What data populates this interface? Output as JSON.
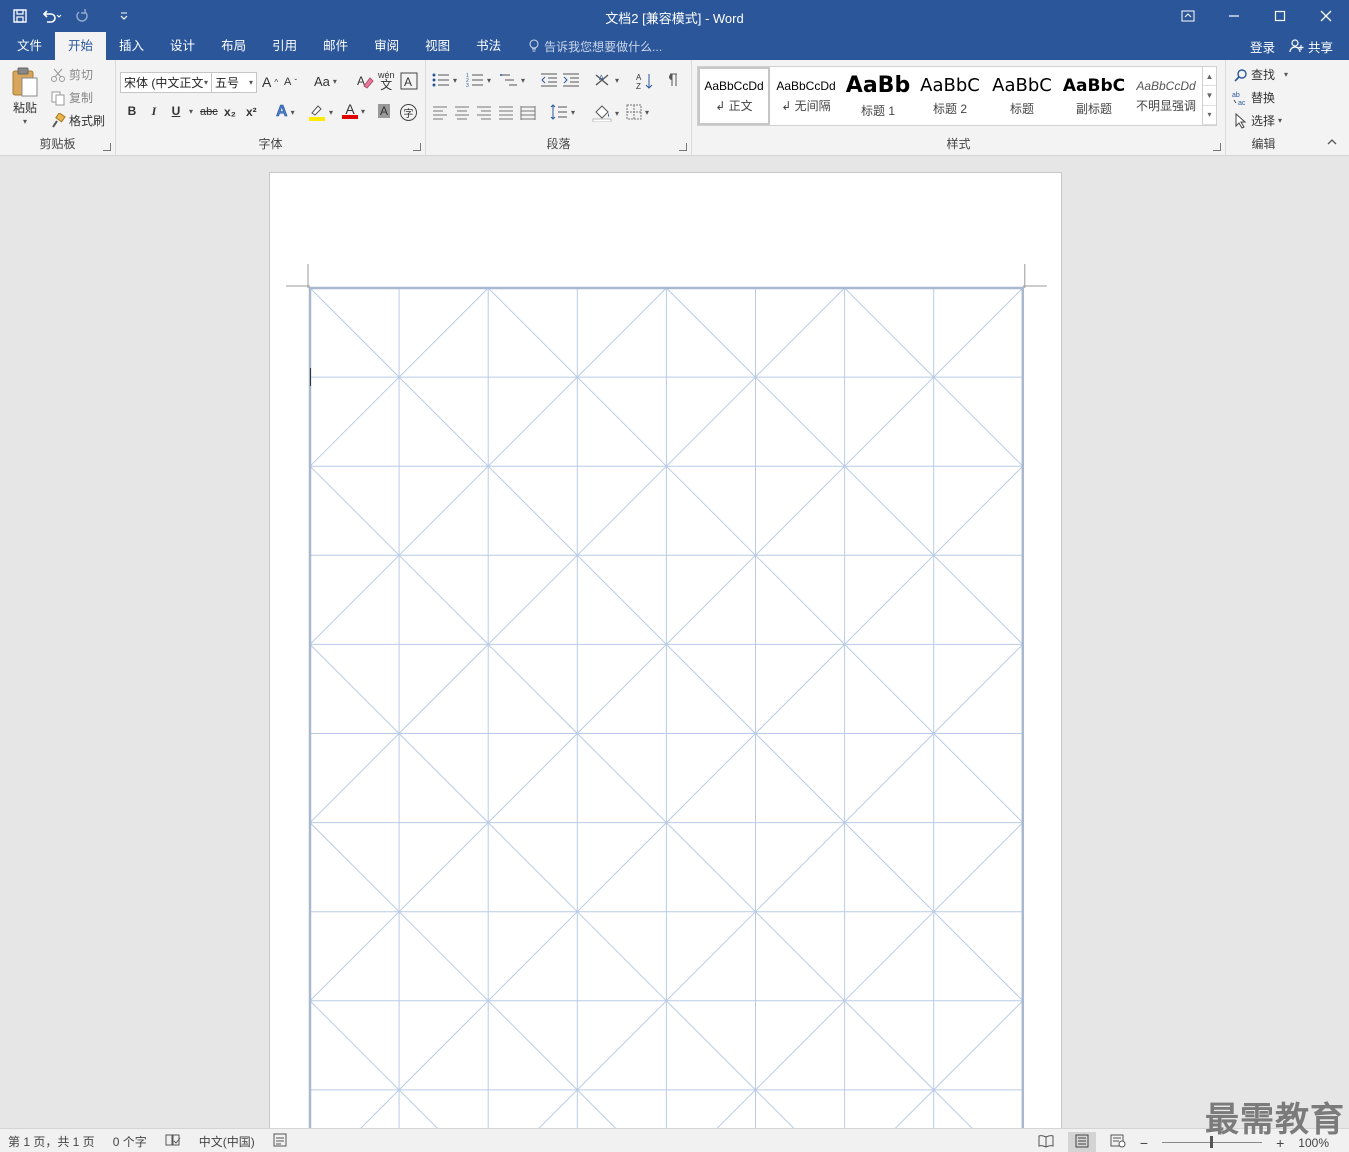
{
  "window": {
    "title": "文档2 [兼容模式] - Word"
  },
  "menu": {
    "tabs": [
      "文件",
      "开始",
      "插入",
      "设计",
      "布局",
      "引用",
      "邮件",
      "审阅",
      "视图",
      "书法"
    ],
    "active_tab": "开始",
    "tell_me": "告诉我您想要做什么...",
    "signin": "登录",
    "share": "共享"
  },
  "ribbon": {
    "clipboard": {
      "label": "剪贴板",
      "paste": "粘贴",
      "cut": "剪切",
      "copy": "复制",
      "format_painter": "格式刷"
    },
    "font": {
      "label": "字体",
      "font_name": "宋体 (中文正文",
      "font_size": "五号",
      "bold": "B",
      "italic": "I",
      "underline": "U",
      "strike": "abc",
      "subscript": "x₂",
      "superscript": "x²",
      "change_case": "Aa",
      "grow": "A",
      "shrink": "A",
      "phonetic_top": "wén",
      "phonetic_bottom": "文",
      "font_color": "A",
      "char_shade": "A",
      "enclose": "字",
      "text_effect": "A"
    },
    "paragraph": {
      "label": "段落"
    },
    "styles": {
      "label": "样式",
      "items": [
        {
          "sample": "AaBbCcDd",
          "name": "↲ 正文"
        },
        {
          "sample": "AaBbCcDd",
          "name": "↲ 无间隔"
        },
        {
          "sample": "AaBb",
          "name": "标题 1"
        },
        {
          "sample": "AaBbC",
          "name": "标题 2"
        },
        {
          "sample": "AaBbC",
          "name": "标题"
        },
        {
          "sample": "AaBbC",
          "name": "副标题"
        },
        {
          "sample": "AaBbCcDd",
          "name": "不明显强调"
        }
      ]
    },
    "editing": {
      "label": "编辑",
      "find": "查找",
      "replace": "替换",
      "select": "选择"
    }
  },
  "document": {
    "grid_columns": 8,
    "grid_rows": 10,
    "grid_color": "#b9cbe6"
  },
  "status": {
    "page": "第 1 页，共 1 页",
    "words": "0 个字",
    "language": "中文(中国)",
    "zoom": "100%"
  },
  "watermark": "最需教育"
}
